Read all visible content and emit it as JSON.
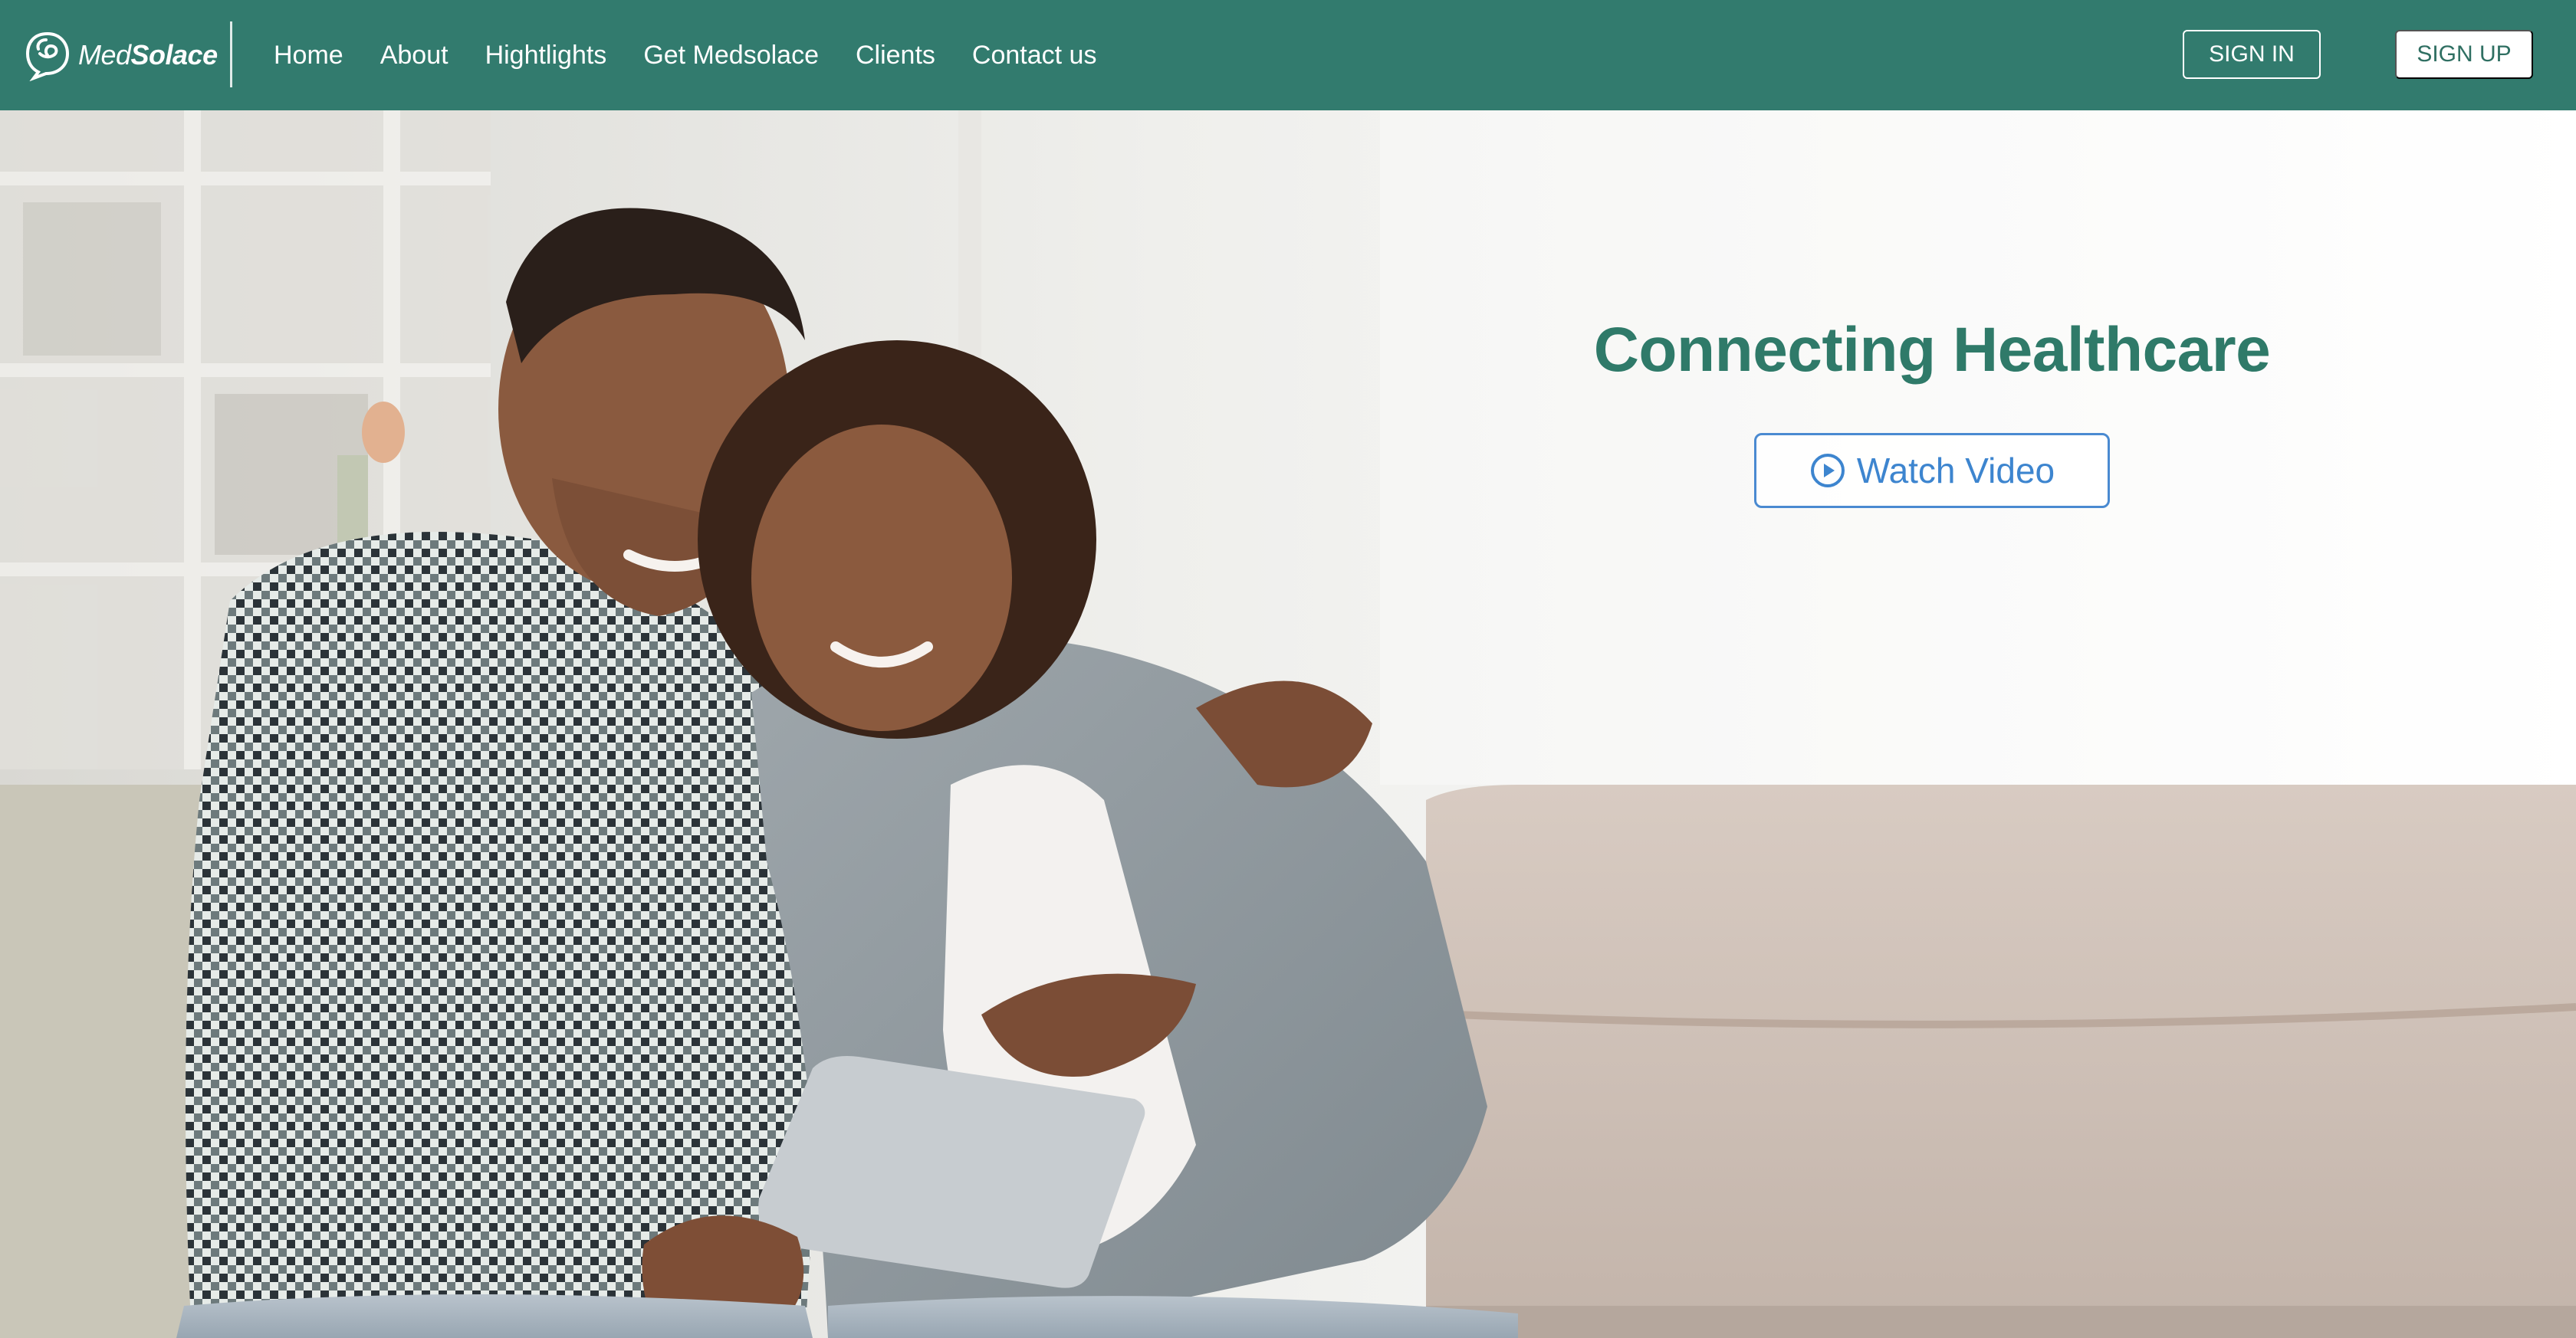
{
  "brand": {
    "name_light": "Med",
    "name_bold": "Solace"
  },
  "nav": {
    "items": [
      {
        "label": "Home"
      },
      {
        "label": "About"
      },
      {
        "label": "Hightlights"
      },
      {
        "label": "Get Medsolace"
      },
      {
        "label": "Clients"
      },
      {
        "label": "Contact us"
      }
    ],
    "sign_in": "SIGN IN",
    "sign_up": "SIGN UP"
  },
  "hero": {
    "title": "Connecting Healthcare",
    "video_button": "Watch Video",
    "video_icon": "play-circle-icon"
  },
  "colors": {
    "nav_bg": "#327b6e",
    "title": "#2f7a69",
    "video_accent": "#3d85cf"
  }
}
